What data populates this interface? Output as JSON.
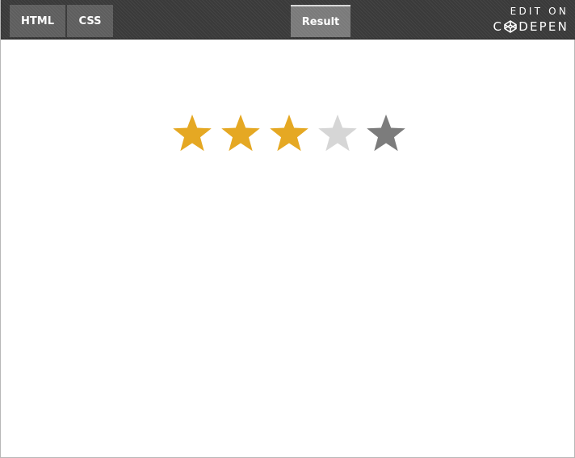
{
  "toolbar": {
    "tabs": [
      {
        "label": "HTML"
      },
      {
        "label": "CSS"
      }
    ],
    "result_tab": {
      "label": "Result"
    },
    "codepen": {
      "edit_on": "EDIT ON",
      "brand_first": "C",
      "brand_rest": "DEPEN"
    }
  },
  "rating": {
    "value": 3,
    "max": 5,
    "hover_index": 5,
    "colors": {
      "filled": "#e5a823",
      "empty": "#d6d6d6",
      "hover": "#7c7c7c"
    },
    "star_icon": "star-icon"
  }
}
